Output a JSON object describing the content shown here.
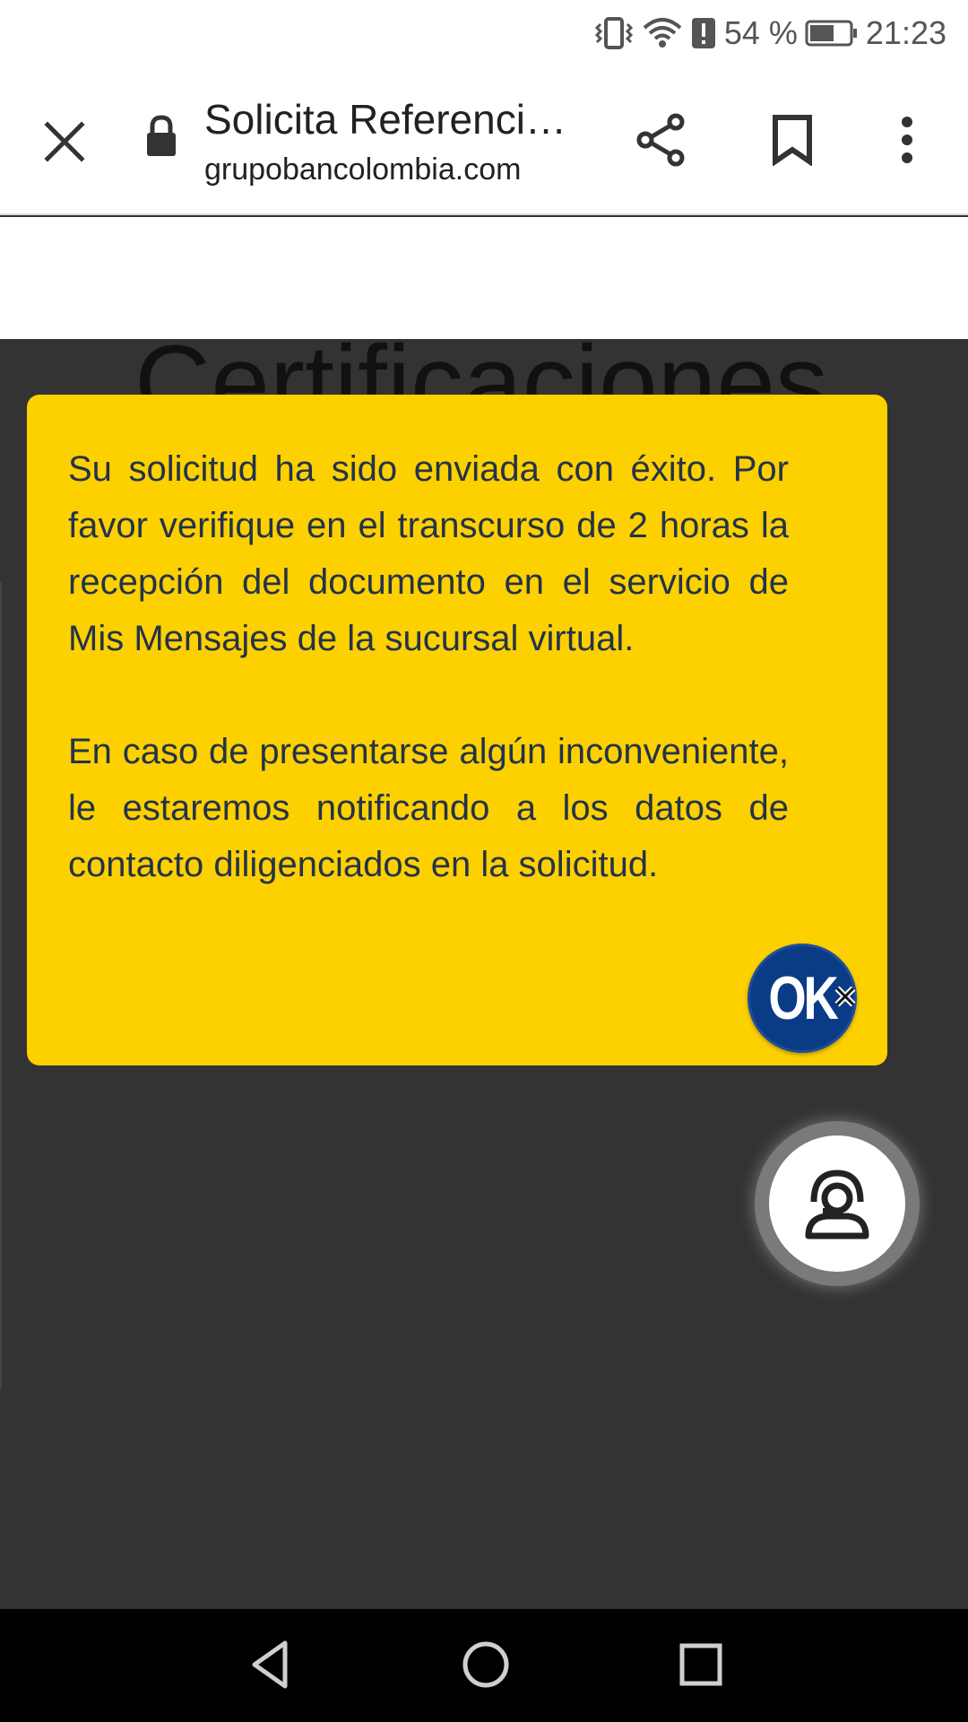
{
  "status_bar": {
    "battery_percent": "54 %",
    "time": "21:23",
    "icons": [
      "vibrate-icon",
      "wifi-icon",
      "alert-icon",
      "battery-icon"
    ]
  },
  "toolbar": {
    "page_title": "Solicita Referenci…",
    "url": "grupobancolombia.com",
    "icons": [
      "close-icon",
      "lock-icon",
      "share-icon",
      "bookmark-icon",
      "more-vert-icon"
    ]
  },
  "page": {
    "heading": "Certificaciones"
  },
  "modal": {
    "paragraph_1": "Su solicitud ha sido enviada con éxito. Por favor verifique en el transcurso de 2 horas la recepción del documento en el servicio de Mis Mensajes de la sucursal virtual.",
    "paragraph_2": "En caso de presentarse algún inconveniente, le estaremos notificando a los datos de contacto diligenciados en la solicitud.",
    "ok_label": "OK",
    "background_color": "#fdd000",
    "text_color": "#23334a",
    "button_color": "#0a3c86"
  },
  "chat": {
    "icon": "agent-support-icon"
  },
  "nav_bar": {
    "icons": [
      "back-icon",
      "home-icon",
      "recents-icon"
    ]
  }
}
